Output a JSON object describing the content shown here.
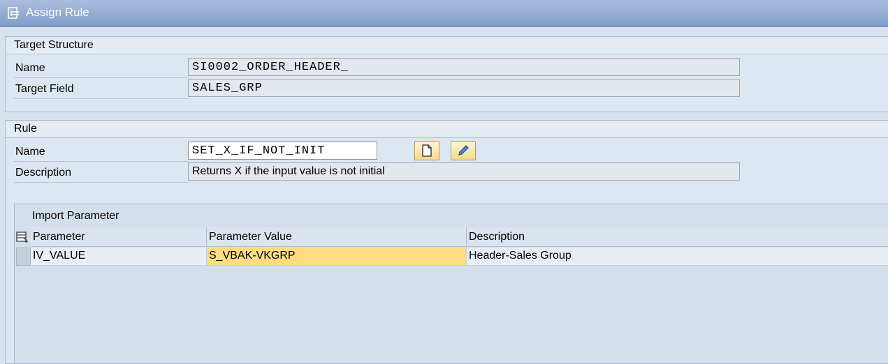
{
  "window": {
    "title": "Assign Rule"
  },
  "target_structure": {
    "header": "Target Structure",
    "name_label": "Name",
    "name_value": "SI0002_ORDER_HEADER_",
    "field_label": "Target Field",
    "field_value": "SALES_GRP"
  },
  "rule": {
    "header": "Rule",
    "name_label": "Name",
    "name_value": "SET_X_IF_NOT_INIT",
    "description_label": "Description",
    "description_value": "Returns X if the input value is not initial",
    "buttons": [
      {
        "icon": "new-document-icon"
      },
      {
        "icon": "pencil-icon"
      }
    ]
  },
  "import_parameter": {
    "title": "Import Parameter",
    "columns": [
      "Parameter",
      "Parameter Value",
      "Description"
    ],
    "rows": [
      {
        "parameter": "IV_VALUE",
        "value": "S_VBAK-VKGRP",
        "description": "Header-Sales Group"
      }
    ]
  },
  "colors": {
    "highlight": "#ffdc80",
    "title_bar": "#8fa9d2",
    "button": "#f3d98c"
  }
}
